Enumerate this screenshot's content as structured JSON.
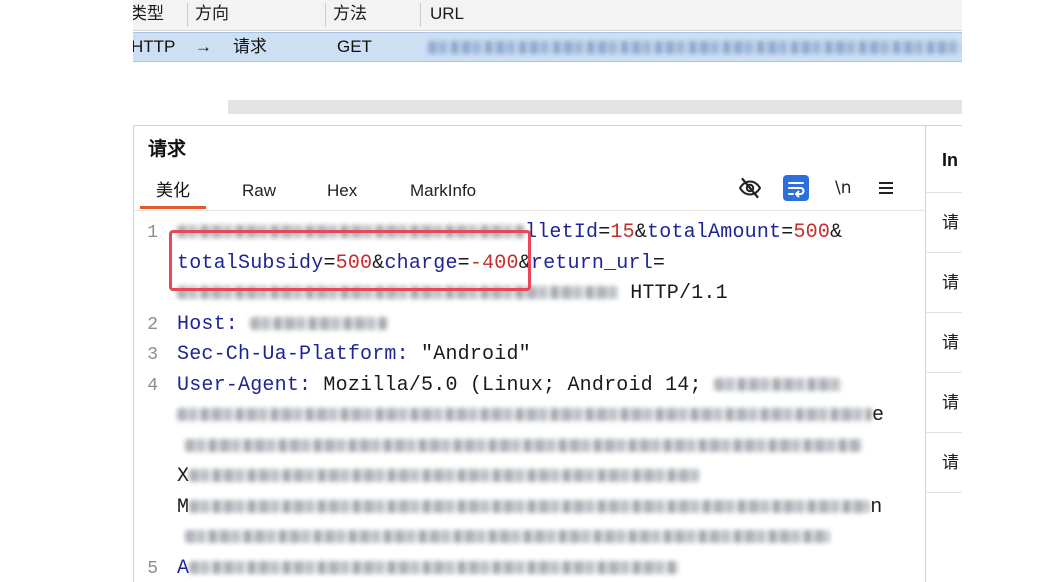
{
  "colors": {
    "accent": "#e25a2a",
    "selection": "#cddff3",
    "highlight_box": "#e9475a",
    "param_name": "#1d2596",
    "param_value": "#c62d2d",
    "wrap_button": "#2d6fdc"
  },
  "history": {
    "columns": [
      "类型",
      "方向",
      "方法",
      "URL"
    ],
    "selected_row": {
      "type": "HTTP",
      "direction_arrow": "→",
      "direction": "请求",
      "method": "GET"
    }
  },
  "request": {
    "title": "请求",
    "tabs": [
      {
        "label": "美化",
        "active": true
      },
      {
        "label": "Raw",
        "active": false
      },
      {
        "label": "Hex",
        "active": false
      },
      {
        "label": "MarkInfo",
        "active": false
      }
    ],
    "toolbar": {
      "icons": [
        "eye-slash-icon",
        "wrap-lines-icon",
        "newline-icon",
        "menu-icon"
      ],
      "newline_label": "\\n"
    }
  },
  "editor": {
    "line_numbers": [
      "1",
      "2",
      "3",
      "4",
      "5"
    ],
    "rows": [
      [
        "lletId",
        "=",
        "15",
        "&",
        "totalAmount",
        "=",
        "500",
        "&"
      ],
      [
        "totalSubsidy",
        "=",
        "500",
        "&",
        "charge",
        "=",
        "-400",
        "&",
        "return_url",
        "="
      ],
      [
        " HTTP/1.1"
      ],
      [
        "Host:",
        " "
      ],
      [
        "Sec-Ch-Ua-Platform:",
        " \"Android\""
      ],
      [
        "User-Agent:",
        " Mozilla/5.0 (Linux; Android 14; "
      ],
      [
        "e"
      ],
      [],
      [
        "X"
      ],
      [
        "M",
        "n"
      ],
      [],
      [
        "A"
      ]
    ]
  },
  "inspector": {
    "title": "In",
    "items": [
      "请",
      "请",
      "请",
      "请",
      "请"
    ]
  }
}
